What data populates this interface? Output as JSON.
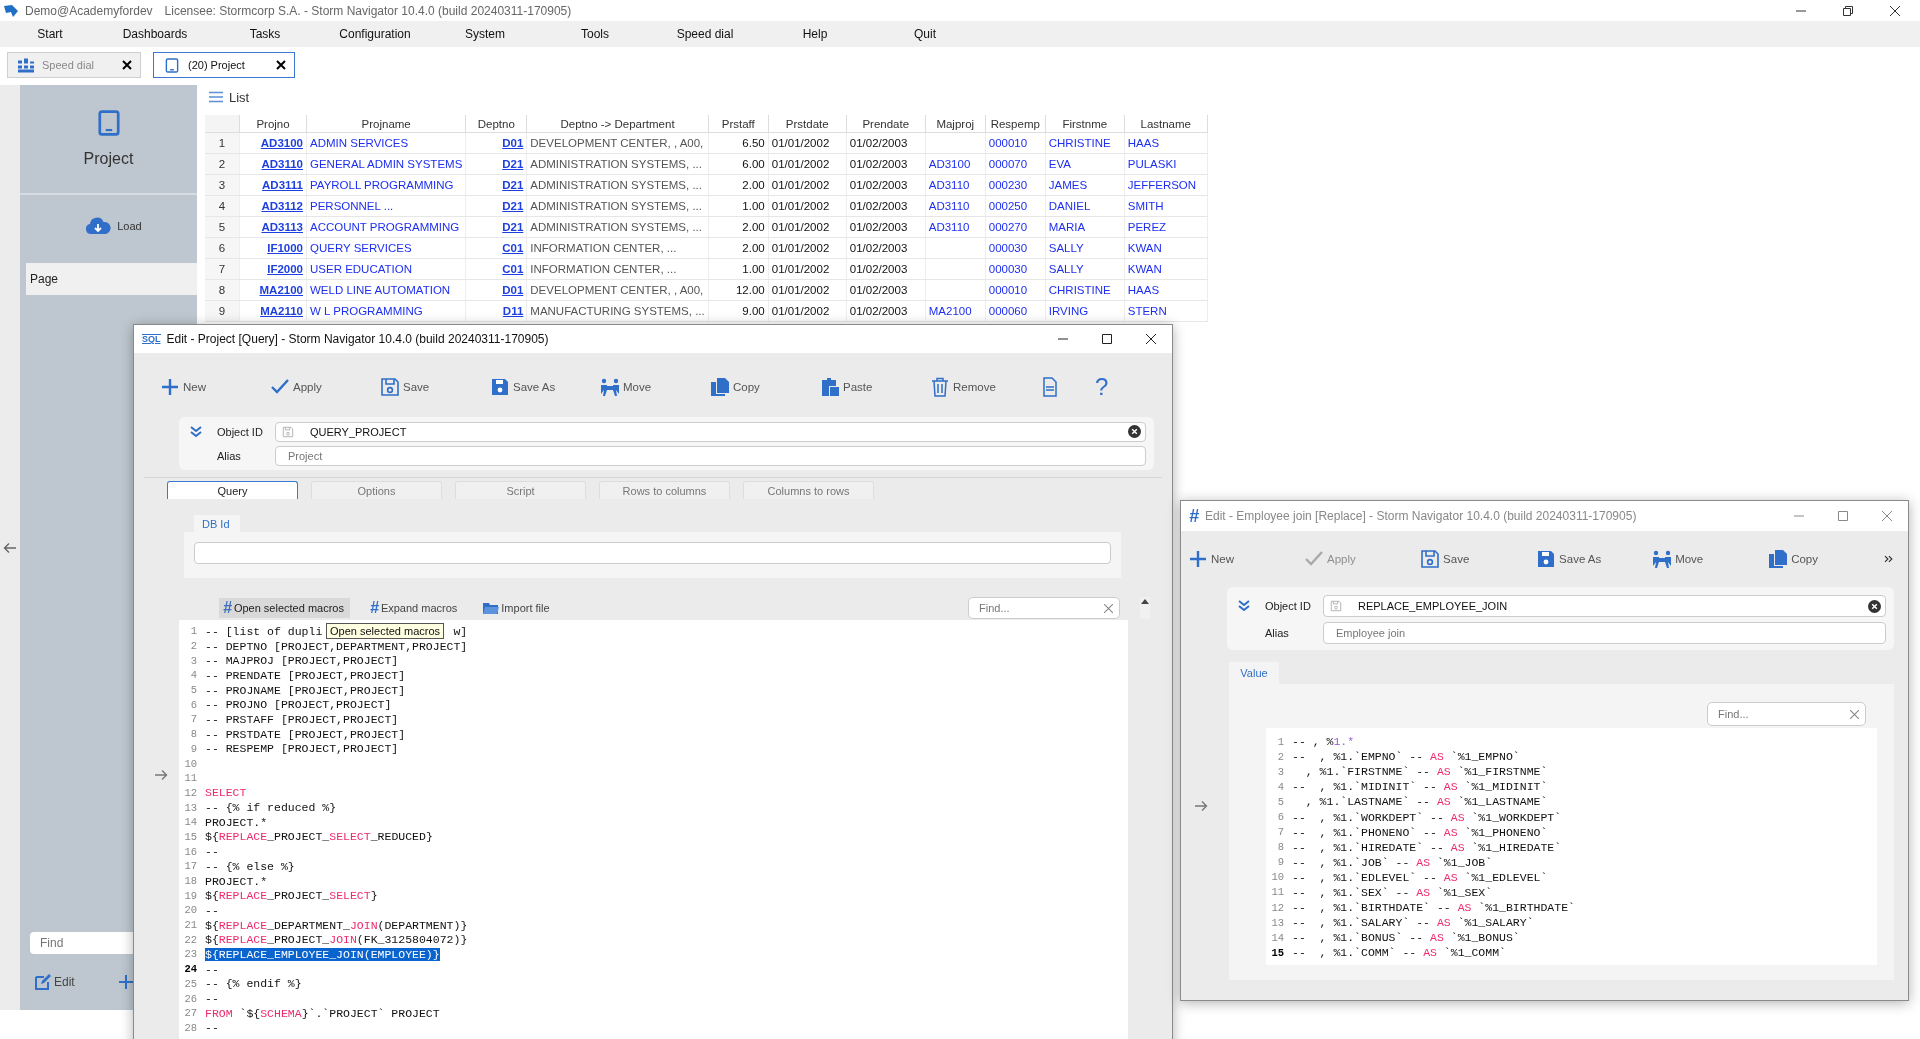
{
  "app": {
    "user": "Demo@Academyfordev",
    "title": "Licensee: Stormcorp S.A. -  Storm Navigator 10.4.0 (build 20240311-170905)"
  },
  "menu": [
    "Start",
    "Dashboards",
    "Tasks",
    "Configuration",
    "System",
    "Tools",
    "Speed dial",
    "Help",
    "Quit"
  ],
  "tabs": [
    {
      "label": "Speed dial",
      "kind": "speed",
      "selected": false
    },
    {
      "label": "(20) Project",
      "kind": "project",
      "selected": true
    }
  ],
  "sidebar": {
    "title": "Project",
    "load": "Load",
    "page": "Page",
    "find_placeholder": "Find",
    "edit": "Edit"
  },
  "list": {
    "title": "List",
    "columns": [
      {
        "label": "Projno",
        "kind": "link"
      },
      {
        "label": "Projname",
        "kind": "ref"
      },
      {
        "label": "Deptno",
        "kind": "link"
      },
      {
        "label": "Deptno -> Department",
        "kind": "muted"
      },
      {
        "label": "Prstaff",
        "kind": "number"
      },
      {
        "label": "Prstdate",
        "kind": "plain"
      },
      {
        "label": "Prendate",
        "kind": "plain"
      },
      {
        "label": "Majproj",
        "kind": "ref"
      },
      {
        "label": "Respemp",
        "kind": "ref"
      },
      {
        "label": "Firstnme",
        "kind": "ref"
      },
      {
        "label": "Lastname",
        "kind": "ref"
      }
    ],
    "rows": [
      {
        "num": "1",
        "cells": [
          "AD3100",
          "ADMIN SERVICES",
          "D01",
          "DEVELOPMENT CENTER, , A00,",
          "6.50",
          "01/01/2002",
          "01/02/2003",
          null,
          "000010",
          "CHRISTINE",
          "HAAS"
        ]
      },
      {
        "num": "2",
        "cells": [
          "AD3110",
          "GENERAL ADMIN SYSTEMS",
          "D21",
          "ADMINISTRATION SYSTEMS, ...",
          "6.00",
          "01/01/2002",
          "01/02/2003",
          "AD3100",
          "000070",
          "EVA",
          "PULASKI"
        ]
      },
      {
        "num": "3",
        "cells": [
          "AD3111",
          "PAYROLL PROGRAMMING",
          "D21",
          "ADMINISTRATION SYSTEMS, ...",
          "2.00",
          "01/01/2002",
          "01/02/2003",
          "AD3110",
          "000230",
          "JAMES",
          "JEFFERSON"
        ]
      },
      {
        "num": "4",
        "cells": [
          "AD3112",
          "PERSONNEL ...",
          "D21",
          "ADMINISTRATION SYSTEMS, ...",
          "1.00",
          "01/01/2002",
          "01/02/2003",
          "AD3110",
          "000250",
          "DANIEL",
          "SMITH"
        ]
      },
      {
        "num": "5",
        "cells": [
          "AD3113",
          "ACCOUNT PROGRAMMING",
          "D21",
          "ADMINISTRATION SYSTEMS, ...",
          "2.00",
          "01/01/2002",
          "01/02/2003",
          "AD3110",
          "000270",
          "MARIA",
          "PEREZ"
        ]
      },
      {
        "num": "6",
        "cells": [
          "IF1000",
          "QUERY SERVICES",
          "C01",
          "INFORMATION CENTER, ...",
          "2.00",
          "01/01/2002",
          "01/02/2003",
          null,
          "000030",
          "SALLY",
          "KWAN"
        ]
      },
      {
        "num": "7",
        "cells": [
          "IF2000",
          "USER EDUCATION",
          "C01",
          "INFORMATION CENTER, ...",
          "1.00",
          "01/01/2002",
          "01/02/2003",
          null,
          "000030",
          "SALLY",
          "KWAN"
        ]
      },
      {
        "num": "8",
        "cells": [
          "MA2100",
          "WELD LINE AUTOMATION",
          "D01",
          "DEVELOPMENT CENTER, , A00,",
          "12.00",
          "01/01/2002",
          "01/02/2003",
          null,
          "000010",
          "CHRISTINE",
          "HAAS"
        ]
      },
      {
        "num": "9",
        "cells": [
          "MA2110",
          "W L PROGRAMMING",
          "D11",
          "MANUFACTURING SYSTEMS, ...",
          "9.00",
          "01/01/2002",
          "01/02/2003",
          "MA2100",
          "000060",
          "IRVING",
          "STERN"
        ]
      }
    ]
  },
  "query_window": {
    "logo": "SQL",
    "title": "Edit - Project [Query] -  Storm Navigator 10.4.0 (build 20240311-170905)",
    "active": true,
    "toolbar": [
      {
        "kind": "new",
        "label": "New",
        "disabled": false
      },
      {
        "kind": "apply",
        "label": "Apply",
        "disabled": false
      },
      {
        "kind": "save",
        "label": "Save",
        "disabled": false
      },
      {
        "kind": "saveas",
        "label": "Save As",
        "disabled": false
      },
      {
        "kind": "move",
        "label": "Move",
        "disabled": false
      },
      {
        "kind": "copy",
        "label": "Copy",
        "disabled": false
      },
      {
        "kind": "paste",
        "label": "Paste",
        "disabled": false
      },
      {
        "kind": "remove",
        "label": "Remove",
        "disabled": false
      },
      {
        "kind": "xml",
        "disabled": false
      },
      {
        "kind": "help",
        "label": "?",
        "disabled": false
      }
    ],
    "object_id_label": "Object ID",
    "object_id": "QUERY_PROJECT",
    "alias_label": "Alias",
    "alias_placeholder": "Project",
    "tabs": [
      {
        "label": "Query",
        "selected": true
      },
      {
        "label": "Options",
        "selected": false
      },
      {
        "label": "Script",
        "selected": false
      },
      {
        "label": "Rows to columns",
        "selected": false
      },
      {
        "label": "Columns to rows",
        "selected": false
      }
    ],
    "db_id_label": "DB Id",
    "macro_tools": [
      {
        "icon": "#",
        "label": "Open selected macros",
        "kind": "hash",
        "highlighted": true
      },
      {
        "icon": "#",
        "label": "Expand macros",
        "kind": "hash",
        "highlighted": false
      },
      {
        "label": "Import file",
        "kind": "folder",
        "highlighted": false
      }
    ],
    "find_placeholder": "Find...",
    "tooltip": "Open selected macros",
    "lines": [
      {
        "n": "1",
        "selected": false,
        "current": false,
        "tokens": [
          {
            "kind": "plain",
            "text": "-- [list of dupli"
          },
          {
            "kind": "tail",
            "text": "w]"
          }
        ]
      },
      {
        "n": "2",
        "selected": false,
        "current": false,
        "tokens": [
          {
            "kind": "plain",
            "text": "-- DEPTNO [PROJECT,DEPARTMENT,PROJECT]"
          }
        ]
      },
      {
        "n": "3",
        "selected": false,
        "current": false,
        "tokens": [
          {
            "kind": "plain",
            "text": "-- MAJPROJ [PROJECT,PROJECT]"
          }
        ]
      },
      {
        "n": "4",
        "selected": false,
        "current": false,
        "tokens": [
          {
            "kind": "plain",
            "text": "-- PRENDATE [PROJECT,PROJECT]"
          }
        ]
      },
      {
        "n": "5",
        "selected": false,
        "current": false,
        "tokens": [
          {
            "kind": "plain",
            "text": "-- PROJNAME [PROJECT,PROJECT]"
          }
        ]
      },
      {
        "n": "6",
        "selected": false,
        "current": false,
        "tokens": [
          {
            "kind": "plain",
            "text": "-- PROJNO [PROJECT,PROJECT]"
          }
        ]
      },
      {
        "n": "7",
        "selected": false,
        "current": false,
        "tokens": [
          {
            "kind": "plain",
            "text": "-- PRSTAFF [PROJECT,PROJECT]"
          }
        ]
      },
      {
        "n": "8",
        "selected": false,
        "current": false,
        "tokens": [
          {
            "kind": "plain",
            "text": "-- PRSTDATE [PROJECT,PROJECT]"
          }
        ]
      },
      {
        "n": "9",
        "selected": false,
        "current": false,
        "tokens": [
          {
            "kind": "plain",
            "text": "-- RESPEMP [PROJECT,PROJECT]"
          }
        ]
      },
      {
        "n": "10",
        "selected": false,
        "current": false
      },
      {
        "n": "11",
        "selected": false,
        "current": false
      },
      {
        "n": "12",
        "selected": false,
        "current": false,
        "tokens": [
          {
            "kind": "keyword",
            "text": "SELECT"
          }
        ]
      },
      {
        "n": "13",
        "selected": false,
        "current": false,
        "tokens": [
          {
            "kind": "plain",
            "text": "-- {% if reduced %}"
          }
        ]
      },
      {
        "n": "14",
        "selected": false,
        "current": false,
        "tokens": [
          {
            "kind": "plain",
            "text": "PROJECT.*"
          }
        ]
      },
      {
        "n": "15",
        "selected": false,
        "current": false,
        "tokens": [
          {
            "kind": "plain",
            "text": "${"
          },
          {
            "kind": "keyword",
            "text": "REPLACE"
          },
          {
            "kind": "plain",
            "text": "_PROJECT_"
          },
          {
            "kind": "keyword",
            "text": "SELECT"
          },
          {
            "kind": "plain",
            "text": "_REDUCED}"
          }
        ]
      },
      {
        "n": "16",
        "selected": false,
        "current": false,
        "tokens": [
          {
            "kind": "plain",
            "text": "--"
          }
        ]
      },
      {
        "n": "17",
        "selected": false,
        "current": false,
        "tokens": [
          {
            "kind": "plain",
            "text": "-- {% else %}"
          }
        ]
      },
      {
        "n": "18",
        "selected": false,
        "current": false,
        "tokens": [
          {
            "kind": "plain",
            "text": "PROJECT.*"
          }
        ]
      },
      {
        "n": "19",
        "selected": false,
        "current": false,
        "tokens": [
          {
            "kind": "plain",
            "text": "${"
          },
          {
            "kind": "keyword",
            "text": "REPLACE"
          },
          {
            "kind": "plain",
            "text": "_PROJECT_"
          },
          {
            "kind": "keyword",
            "text": "SELECT"
          },
          {
            "kind": "plain",
            "text": "}"
          }
        ]
      },
      {
        "n": "20",
        "selected": false,
        "current": false,
        "tokens": [
          {
            "kind": "plain",
            "text": "--"
          }
        ]
      },
      {
        "n": "21",
        "selected": false,
        "current": false,
        "tokens": [
          {
            "kind": "plain",
            "text": "${"
          },
          {
            "kind": "keyword",
            "text": "REPLACE"
          },
          {
            "kind": "plain",
            "text": "_DEPARTMENT_"
          },
          {
            "kind": "keyword",
            "text": "JOIN"
          },
          {
            "kind": "plain",
            "text": "(DEPARTMENT)}"
          }
        ]
      },
      {
        "n": "22",
        "selected": false,
        "current": false,
        "tokens": [
          {
            "kind": "plain",
            "text": "${"
          },
          {
            "kind": "keyword",
            "text": "REPLACE"
          },
          {
            "kind": "plain",
            "text": "_PROJECT_"
          },
          {
            "kind": "keyword",
            "text": "JOIN"
          },
          {
            "kind": "plain",
            "text": "(FK_3125804072)}"
          }
        ]
      },
      {
        "n": "23",
        "selected": true,
        "current": false,
        "tokens": [
          {
            "kind": "plain",
            "text": "${REPLACE_EMPLOYEE_JOIN(EMPLOYEE)}"
          }
        ]
      },
      {
        "n": "24",
        "selected": false,
        "current": true,
        "tokens": [
          {
            "kind": "plain",
            "text": "--"
          }
        ]
      },
      {
        "n": "25",
        "selected": false,
        "current": false,
        "tokens": [
          {
            "kind": "plain",
            "text": "-- {% endif %}"
          }
        ]
      },
      {
        "n": "26",
        "selected": false,
        "current": false,
        "tokens": [
          {
            "kind": "plain",
            "text": "--"
          }
        ]
      },
      {
        "n": "27",
        "selected": false,
        "current": false,
        "tokens": [
          {
            "kind": "keyword",
            "text": "FROM"
          },
          {
            "kind": "plain",
            "text": " `${"
          },
          {
            "kind": "keyword",
            "text": "SCHEMA"
          },
          {
            "kind": "plain",
            "text": "}`.`PROJECT` PROJECT"
          }
        ]
      },
      {
        "n": "28",
        "selected": false,
        "current": false,
        "tokens": [
          {
            "kind": "plain",
            "text": "--"
          }
        ]
      }
    ]
  },
  "replace_window": {
    "logo": "#",
    "title": "Edit - Employee join [Replace] -  Storm Navigator 10.4.0 (build 20240311-170905)",
    "active": false,
    "toolbar": [
      {
        "kind": "new",
        "label": "New",
        "disabled": false
      },
      {
        "kind": "apply",
        "label": "Apply",
        "disabled": true
      },
      {
        "kind": "save",
        "label": "Save",
        "disabled": false
      },
      {
        "kind": "saveas",
        "label": "Save As",
        "disabled": false
      },
      {
        "kind": "move",
        "label": "Move",
        "disabled": false
      },
      {
        "kind": "copy",
        "label": "Copy",
        "disabled": false
      }
    ],
    "object_id_label": "Object ID",
    "object_id": "REPLACE_EMPLOYEE_JOIN",
    "alias_label": "Alias",
    "alias_placeholder": "Employee join",
    "tabs": [
      {
        "label": "Value",
        "selected": true
      }
    ],
    "find_placeholder": "Find...",
    "lines": [
      {
        "n": "1",
        "current": false,
        "tokens": [
          {
            "kind": "plain",
            "text": "-- , %"
          },
          {
            "kind": "number",
            "text": "1.*"
          }
        ]
      },
      {
        "n": "2",
        "current": false,
        "tokens": [
          {
            "kind": "plain",
            "text": "--  , %1.`EMPNO` -- "
          },
          {
            "kind": "keyword",
            "text": "AS"
          },
          {
            "kind": "plain",
            "text": " `%1_EMPNO`"
          }
        ]
      },
      {
        "n": "3",
        "current": false,
        "tokens": [
          {
            "kind": "plain",
            "text": "  , %1.`FIRSTNME` -- "
          },
          {
            "kind": "keyword",
            "text": "AS"
          },
          {
            "kind": "plain",
            "text": " `%1_FIRSTNME`"
          }
        ]
      },
      {
        "n": "4",
        "current": false,
        "tokens": [
          {
            "kind": "plain",
            "text": "--  , %1.`MIDINIT` -- "
          },
          {
            "kind": "keyword",
            "text": "AS"
          },
          {
            "kind": "plain",
            "text": " `%1_MIDINIT`"
          }
        ]
      },
      {
        "n": "5",
        "current": false,
        "tokens": [
          {
            "kind": "plain",
            "text": "  , %1.`LASTNAME` -- "
          },
          {
            "kind": "keyword",
            "text": "AS"
          },
          {
            "kind": "plain",
            "text": " `%1_LASTNAME`"
          }
        ]
      },
      {
        "n": "6",
        "current": false,
        "tokens": [
          {
            "kind": "plain",
            "text": "--  , %1.`WORKDEPT` -- "
          },
          {
            "kind": "keyword",
            "text": "AS"
          },
          {
            "kind": "plain",
            "text": " `%1_WORKDEPT`"
          }
        ]
      },
      {
        "n": "7",
        "current": false,
        "tokens": [
          {
            "kind": "plain",
            "text": "--  , %1.`PHONENO` -- "
          },
          {
            "kind": "keyword",
            "text": "AS"
          },
          {
            "kind": "plain",
            "text": " `%1_PHONENO`"
          }
        ]
      },
      {
        "n": "8",
        "current": false,
        "tokens": [
          {
            "kind": "plain",
            "text": "--  , %1.`HIREDATE` -- "
          },
          {
            "kind": "keyword",
            "text": "AS"
          },
          {
            "kind": "plain",
            "text": " `%1_HIREDATE`"
          }
        ]
      },
      {
        "n": "9",
        "current": false,
        "tokens": [
          {
            "kind": "plain",
            "text": "--  , %1.`JOB` -- "
          },
          {
            "kind": "keyword",
            "text": "AS"
          },
          {
            "kind": "plain",
            "text": " `%1_JOB`"
          }
        ]
      },
      {
        "n": "10",
        "current": false,
        "tokens": [
          {
            "kind": "plain",
            "text": "--  , %1.`EDLEVEL` -- "
          },
          {
            "kind": "keyword",
            "text": "AS"
          },
          {
            "kind": "plain",
            "text": " `%1_EDLEVEL`"
          }
        ]
      },
      {
        "n": "11",
        "current": false,
        "tokens": [
          {
            "kind": "plain",
            "text": "--  , %1.`SEX` -- "
          },
          {
            "kind": "keyword",
            "text": "AS"
          },
          {
            "kind": "plain",
            "text": " `%1_SEX`"
          }
        ]
      },
      {
        "n": "12",
        "current": false,
        "tokens": [
          {
            "kind": "plain",
            "text": "--  , %1.`BIRTHDATE` -- "
          },
          {
            "kind": "keyword",
            "text": "AS"
          },
          {
            "kind": "plain",
            "text": " `%1_BIRTHDATE`"
          }
        ]
      },
      {
        "n": "13",
        "current": false,
        "tokens": [
          {
            "kind": "plain",
            "text": "--  , %1.`SALARY` -- "
          },
          {
            "kind": "keyword",
            "text": "AS"
          },
          {
            "kind": "plain",
            "text": " `%1_SALARY`"
          }
        ]
      },
      {
        "n": "14",
        "current": false,
        "tokens": [
          {
            "kind": "plain",
            "text": "--  , %1.`BONUS` -- "
          },
          {
            "kind": "keyword",
            "text": "AS"
          },
          {
            "kind": "plain",
            "text": " `%1_BONUS`"
          }
        ]
      },
      {
        "n": "15",
        "current": true,
        "tokens": [
          {
            "kind": "plain",
            "text": "--  , %1.`COMM` -- "
          },
          {
            "kind": "keyword",
            "text": "AS"
          },
          {
            "kind": "plain",
            "text": " `%1_COMM`"
          }
        ]
      }
    ]
  }
}
